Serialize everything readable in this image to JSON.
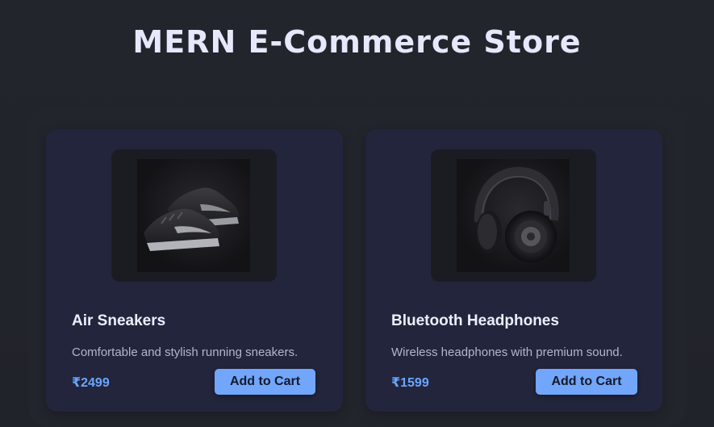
{
  "page": {
    "title": "MERN E-Commerce Store"
  },
  "products": [
    {
      "name": "Air Sneakers",
      "description": "Comfortable and stylish running sneakers.",
      "price": "₹2499",
      "button_label": "Add to Cart",
      "image_icon": "sneaker-image"
    },
    {
      "name": "Bluetooth Headphones",
      "description": "Wireless headphones with premium sound.",
      "price": "₹1599",
      "button_label": "Add to Cart",
      "image_icon": "headphones-image"
    }
  ],
  "colors": {
    "background": "#23252c",
    "card": "#23253d",
    "accent": "#72a6fb",
    "price": "#6aa6ff",
    "title": "#e6e8fb"
  }
}
